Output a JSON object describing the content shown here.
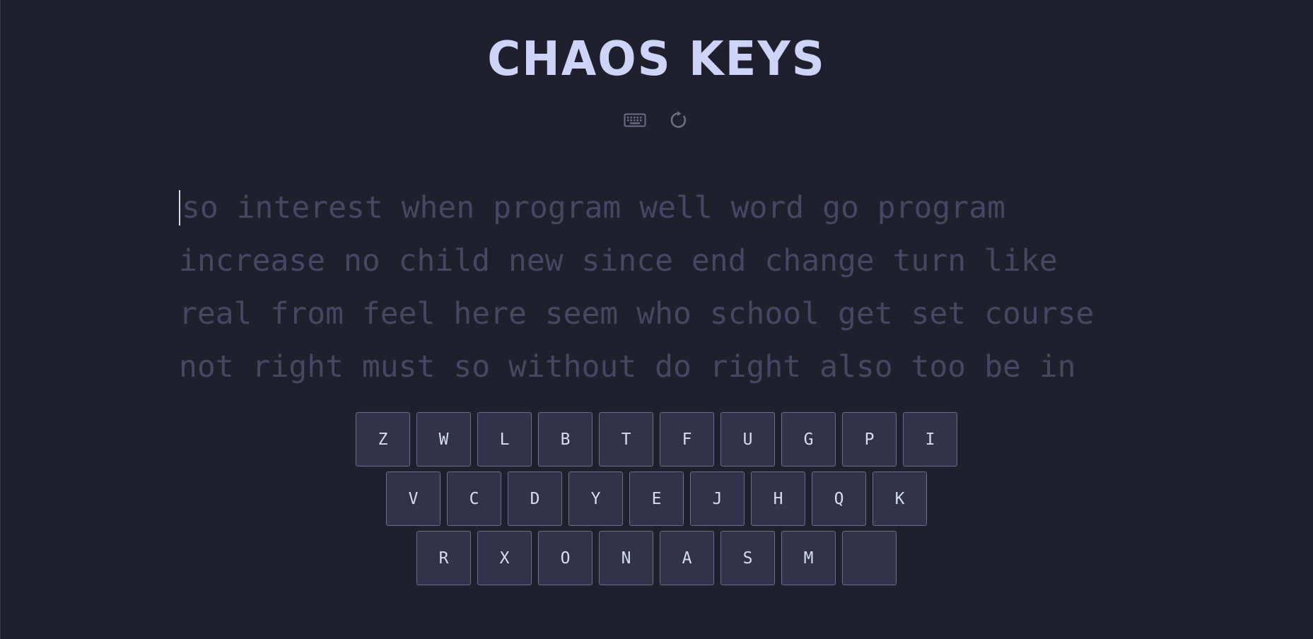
{
  "app": {
    "title": "CHAOS KEYS"
  },
  "toolbar": {
    "keyboard_icon": "keyboard-icon",
    "restart_icon": "restart-icon"
  },
  "typing": {
    "lines": [
      "so interest when program well word go program",
      "increase no child new since end change turn like",
      "real from feel here seem who school get set course",
      "not right must so without do right also too be in"
    ]
  },
  "keyboard": {
    "rows": [
      [
        "Z",
        "W",
        "L",
        "B",
        "T",
        "F",
        "U",
        "G",
        "P",
        "I"
      ],
      [
        "V",
        "C",
        "D",
        "Y",
        "E",
        "J",
        "H",
        "Q",
        "K"
      ],
      [
        "R",
        "X",
        "O",
        "N",
        "A",
        "S",
        "M",
        ""
      ]
    ]
  },
  "colors": {
    "background": "#1f1f2e",
    "title": "#cdd4f7",
    "pending_text": "#454862",
    "key_background": "#32334a",
    "key_border": "#6b6d86",
    "key_text": "#d6dcf5",
    "caret": "#d9dcef"
  }
}
